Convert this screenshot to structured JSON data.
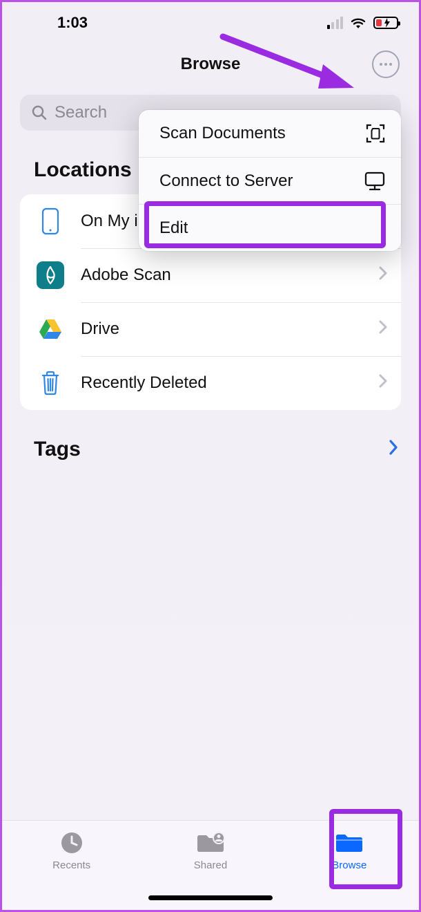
{
  "statusbar": {
    "time": "1:03"
  },
  "nav": {
    "title": "Browse"
  },
  "search": {
    "placeholder": "Search"
  },
  "popover": {
    "items": [
      {
        "label": "Scan Documents"
      },
      {
        "label": "Connect to Server"
      },
      {
        "label": "Edit"
      }
    ]
  },
  "sections": {
    "locations": {
      "title": "Locations",
      "items": [
        {
          "label": "On My iPhone"
        },
        {
          "label": "Adobe Scan"
        },
        {
          "label": "Drive"
        },
        {
          "label": "Recently Deleted"
        }
      ]
    },
    "tags": {
      "title": "Tags"
    }
  },
  "tabbar": {
    "recents": "Recents",
    "shared": "Shared",
    "browse": "Browse"
  }
}
